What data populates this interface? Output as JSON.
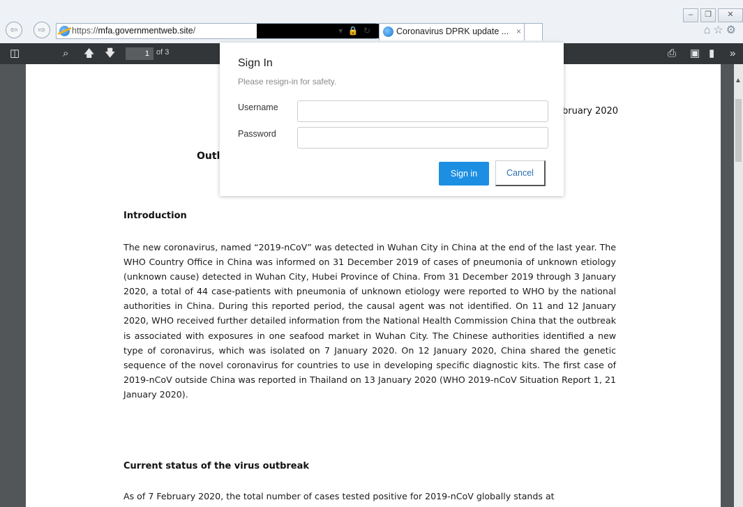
{
  "browser": {
    "url_scheme": "https://",
    "url_domain": "mfa.governmentweb.site",
    "url_path": "/",
    "tab_title": "Coronavirus DPRK update ...",
    "tab_close": "×"
  },
  "pdf_toolbar": {
    "current_page": "1",
    "page_count_label": "of 3"
  },
  "document": {
    "date_fragment": "bruary 2020",
    "title_fragment": "Outl",
    "intro_heading": "Introduction",
    "intro_paragraph": "The new coronavirus, named “2019-nCoV” was detected in Wuhan City in China at the end of the last year. The WHO Country Office in China was informed on 31 December 2019 of cases of pneumonia of unknown etiology (unknown cause) detected in Wuhan City, Hubei Province of China. From 31 December 2019 through 3 January 2020, a total of 44 case-patients with pneumonia of unknown etiology were reported to WHO by the national authorities in China. During this reported period, the causal agent was not identified. On 11 and 12 January 2020, WHO received further detailed information from the National Health Commission China that the outbreak is associated with exposures in one seafood market in Wuhan City. The Chinese authorities identified a new type of coronavirus, which was isolated on 7 January 2020. On 12 January 2020, China shared the genetic sequence of the novel coronavirus for countries to use in developing specific diagnostic kits. The first case of 2019-nCoV outside China was reported in Thailand on 13 January 2020 (WHO 2019-nCoV Situation Report 1, 21 January 2020).",
    "status_heading": "Current status of the virus outbreak",
    "status_paragraph": "As of 7 February 2020, the total number of cases tested positive for 2019-nCoV globally stands at"
  },
  "signin_dialog": {
    "title": "Sign In",
    "subtitle": "Please resign-in for safety.",
    "username_label": "Username",
    "username_value": "",
    "password_label": "Password",
    "password_value": "",
    "signin_button": "Sign in",
    "cancel_button": "Cancel"
  },
  "icons": {
    "back": "back-arrow-icon",
    "forward": "forward-arrow-icon",
    "ie_logo": "ie-logo-icon",
    "lock": "lock-icon",
    "refresh": "refresh-icon",
    "home": "home-icon",
    "favorites": "star-icon",
    "settings": "gear-icon",
    "sidebar": "sidebar-toggle-icon",
    "search": "search-icon",
    "prev_page": "up-arrow-icon",
    "next_page": "down-arrow-icon",
    "print": "print-icon",
    "save": "save-icon",
    "bookmark": "bookmark-icon",
    "more": "chevron-double-right-icon"
  }
}
